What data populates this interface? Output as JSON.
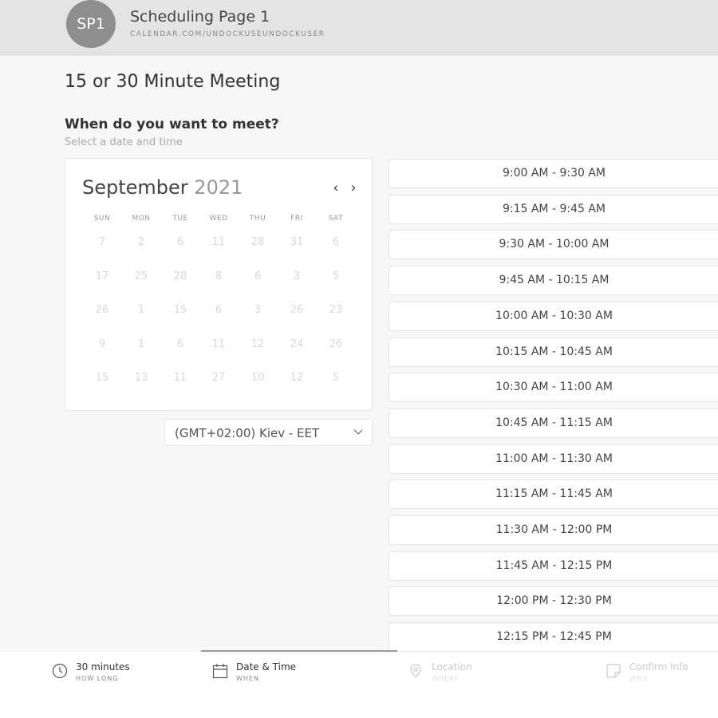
{
  "header": {
    "avatar_initials": "SP1",
    "title": "Scheduling Page 1",
    "subtitle": "CALENDAR.COM/UNDOCKUSEUNDOCKUSER"
  },
  "meeting": {
    "title": "15 or 30 Minute Meeting",
    "question": "When do you want to meet?",
    "hint": "Select a date and time"
  },
  "calendar": {
    "month": "September",
    "year": "2021",
    "prev_icon": "‹",
    "next_icon": "›",
    "weekdays": [
      "SUN",
      "MON",
      "TUE",
      "WED",
      "THU",
      "FRI",
      "SAT"
    ],
    "weeks": [
      [
        "7",
        "2",
        "6",
        "11",
        "28",
        "31",
        "6"
      ],
      [
        "17",
        "25",
        "28",
        "8",
        "6",
        "3",
        "5"
      ],
      [
        "26",
        "1",
        "15",
        "6",
        "3",
        "26",
        "23"
      ],
      [
        "9",
        "1",
        "6",
        "11",
        "12",
        "24",
        "26"
      ],
      [
        "15",
        "13",
        "11",
        "27",
        "10",
        "12",
        "5"
      ]
    ]
  },
  "timezone": {
    "value": "(GMT+02:00) Kiev - EET",
    "icon": "chevron-down-icon"
  },
  "slots": [
    "9:00 AM - 9:30 AM",
    "9:15 AM - 9:45 AM",
    "9:30 AM - 10:00 AM",
    "9:45 AM - 10:15 AM",
    "10:00 AM - 10:30 AM",
    "10:15 AM - 10:45 AM",
    "10:30 AM - 11:00 AM",
    "10:45 AM - 11:15 AM",
    "11:00 AM - 11:30 AM",
    "11:15 AM - 11:45 AM",
    "11:30 AM - 12:00 PM",
    "11:45 AM - 12:15 PM",
    "12:00 PM - 12:30 PM",
    "12:15 PM - 12:45 PM"
  ],
  "footer": {
    "steps": [
      {
        "label": "30 minutes",
        "sub": "HOW LONG",
        "icon": "clock-icon"
      },
      {
        "label": "Date & Time",
        "sub": "WHEN",
        "icon": "calendar-icon"
      },
      {
        "label": "Location",
        "sub": "WHERE",
        "icon": "location-pin-icon"
      },
      {
        "label": "Confirm Info",
        "sub": "WHO",
        "icon": "note-icon"
      }
    ]
  }
}
